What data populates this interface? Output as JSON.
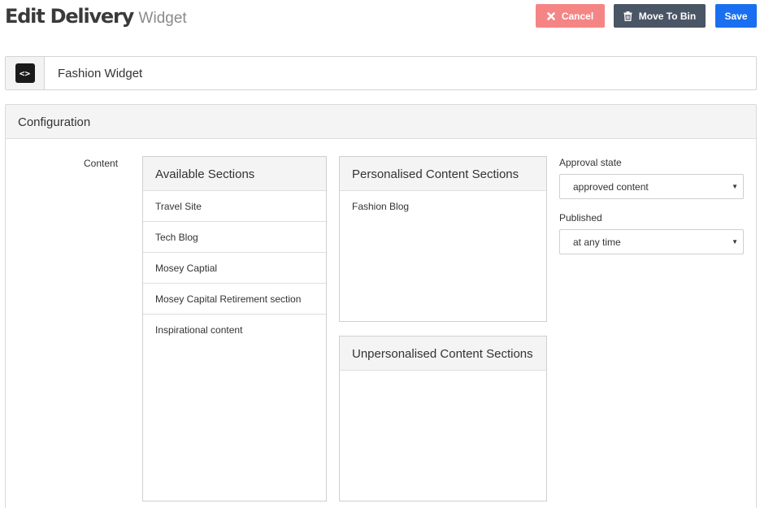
{
  "header": {
    "title": "Edit Delivery",
    "subtitle": "Widget"
  },
  "toolbar": {
    "cancel_label": "Cancel",
    "cancel_icon": "x-icon",
    "bin_label": "Move To Bin",
    "bin_icon": "trash-icon",
    "save_label": "Save",
    "colors": {
      "cancel": "#f58585",
      "bin": "#4a5565",
      "save": "#1a6ff0"
    }
  },
  "widget": {
    "icon": "code-icon",
    "icon_glyph": "<>",
    "name": "Fashion Widget"
  },
  "config": {
    "title": "Configuration",
    "content_label": "Content",
    "available": {
      "title": "Available Sections",
      "items": [
        "Travel Site",
        "Tech Blog",
        "Mosey Captial",
        "Mosey Capital Retirement section",
        "Inspirational content"
      ]
    },
    "personalised": {
      "title": "Personalised Content Sections",
      "items": [
        "Fashion Blog"
      ]
    },
    "unpersonalised": {
      "title": "Unpersonalised Content Sections",
      "items": []
    },
    "approval": {
      "label": "Approval state",
      "value": "approved content"
    },
    "published": {
      "label": "Published",
      "value": "at any time"
    }
  }
}
